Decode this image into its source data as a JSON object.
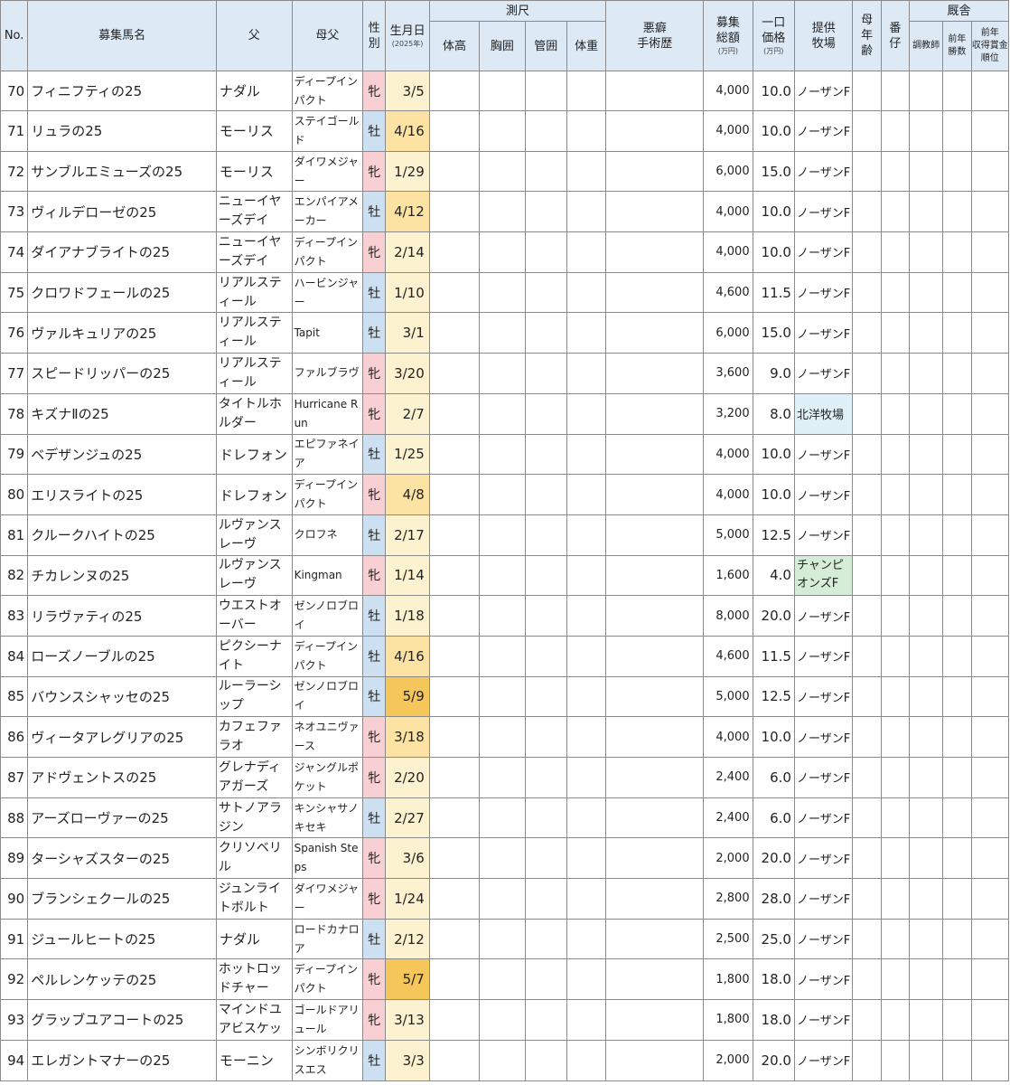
{
  "headers": {
    "no": "No.",
    "name": "募集馬名",
    "sire": "父",
    "dam_sire": "母父",
    "sex": "性別",
    "birth": "生月日",
    "birth_year": "(2025年)",
    "measure_group": "測尺",
    "height": "体高",
    "chest": "胸囲",
    "cannon": "管囲",
    "weight": "体重",
    "vice_line1": "悪癖",
    "vice_line2": "手術歴",
    "total_line1": "募集",
    "total_line2": "総額",
    "total_unit": "(万円)",
    "price_line1": "一口",
    "price_line2": "価格",
    "price_unit": "(万円)",
    "farm_line1": "提供",
    "farm_line2": "牧場",
    "dam_age_line1": "母",
    "dam_age_line2": "年",
    "dam_age_line3": "齢",
    "birth_order_line1": "番",
    "birth_order_line2": "仔",
    "stable_group": "厩舎",
    "trainer": "調教師",
    "prev_wins_line1": "前年",
    "prev_wins_line2": "勝数",
    "prev_rank_line1": "前年",
    "prev_rank_line2": "収得賞金",
    "prev_rank_line3": "順位"
  },
  "rows": [
    {
      "no": "70",
      "name": "フィニフティの25",
      "sire": "ナダル",
      "dam_sire": "ディープインパクト",
      "sex": "牝",
      "birth": "3/5",
      "total": "4,000",
      "price": "10.0",
      "farm": "ノーザンF"
    },
    {
      "no": "71",
      "name": "リュラの25",
      "sire": "モーリス",
      "dam_sire": "ステイゴールド",
      "sex": "牡",
      "birth": "4/16",
      "total": "4,000",
      "price": "10.0",
      "farm": "ノーザンF"
    },
    {
      "no": "72",
      "name": "サンブルエミューズの25",
      "sire": "モーリス",
      "dam_sire": "ダイワメジャー",
      "sex": "牝",
      "birth": "1/29",
      "total": "6,000",
      "price": "15.0",
      "farm": "ノーザンF"
    },
    {
      "no": "73",
      "name": "ヴィルデローゼの25",
      "sire": "ニューイヤーズデイ",
      "dam_sire": "エンパイアメーカー",
      "sex": "牡",
      "birth": "4/12",
      "total": "4,000",
      "price": "10.0",
      "farm": "ノーザンF"
    },
    {
      "no": "74",
      "name": "ダイアナブライトの25",
      "sire": "ニューイヤーズデイ",
      "dam_sire": "ディープインパクト",
      "sex": "牝",
      "birth": "2/14",
      "total": "4,000",
      "price": "10.0",
      "farm": "ノーザンF"
    },
    {
      "no": "75",
      "name": "クロワドフェールの25",
      "sire": "リアルスティール",
      "dam_sire": "ハービンジャー",
      "sex": "牡",
      "birth": "1/10",
      "total": "4,600",
      "price": "11.5",
      "farm": "ノーザンF"
    },
    {
      "no": "76",
      "name": "ヴァルキュリアの25",
      "sire": "リアルスティール",
      "dam_sire": "Tapit",
      "sex": "牡",
      "birth": "3/1",
      "total": "6,000",
      "price": "15.0",
      "farm": "ノーザンF"
    },
    {
      "no": "77",
      "name": "スピードリッパーの25",
      "sire": "リアルスティール",
      "dam_sire": "ファルブラヴ",
      "sex": "牝",
      "birth": "3/20",
      "total": "3,600",
      "price": "9.0",
      "farm": "ノーザンF"
    },
    {
      "no": "78",
      "name": "キズナⅡの25",
      "sire": "タイトルホルダー",
      "dam_sire": "Hurricane Run",
      "sex": "牝",
      "birth": "2/7",
      "total": "3,200",
      "price": "8.0",
      "farm": "北洋牧場"
    },
    {
      "no": "79",
      "name": "ベデザンジュの25",
      "sire": "ドレフォン",
      "dam_sire": "エピファネイア",
      "sex": "牡",
      "birth": "1/25",
      "total": "4,000",
      "price": "10.0",
      "farm": "ノーザンF"
    },
    {
      "no": "80",
      "name": "エリスライトの25",
      "sire": "ドレフォン",
      "dam_sire": "ディープインパクト",
      "sex": "牝",
      "birth": "4/8",
      "total": "4,000",
      "price": "10.0",
      "farm": "ノーザンF"
    },
    {
      "no": "81",
      "name": "クルークハイトの25",
      "sire": "ルヴァンスレーヴ",
      "dam_sire": "クロフネ",
      "sex": "牡",
      "birth": "2/17",
      "total": "5,000",
      "price": "12.5",
      "farm": "ノーザンF"
    },
    {
      "no": "82",
      "name": "チカレンヌの25",
      "sire": "ルヴァンスレーヴ",
      "dam_sire": "Kingman",
      "sex": "牝",
      "birth": "1/14",
      "total": "1,600",
      "price": "4.0",
      "farm": "チャンピオンズF"
    },
    {
      "no": "83",
      "name": "リラヴァティの25",
      "sire": "ウエストオーバー",
      "dam_sire": "ゼンノロブロイ",
      "sex": "牡",
      "birth": "1/18",
      "total": "8,000",
      "price": "20.0",
      "farm": "ノーザンF"
    },
    {
      "no": "84",
      "name": "ローズノーブルの25",
      "sire": "ピクシーナイト",
      "dam_sire": "ディープインパクト",
      "sex": "牡",
      "birth": "4/16",
      "total": "4,600",
      "price": "11.5",
      "farm": "ノーザンF"
    },
    {
      "no": "85",
      "name": "バウンスシャッセの25",
      "sire": "ルーラーシップ",
      "dam_sire": "ゼンノロブロイ",
      "sex": "牡",
      "birth": "5/9",
      "total": "5,000",
      "price": "12.5",
      "farm": "ノーザンF"
    },
    {
      "no": "86",
      "name": "ヴィータアレグリアの25",
      "sire": "カフェファラオ",
      "dam_sire": "ネオユニヴァース",
      "sex": "牝",
      "birth": "3/18",
      "total": "4,000",
      "price": "10.0",
      "farm": "ノーザンF"
    },
    {
      "no": "87",
      "name": "アドヴェントスの25",
      "sire": "グレナディアガーズ",
      "dam_sire": "ジャングルポケット",
      "sex": "牝",
      "birth": "2/20",
      "total": "2,400",
      "price": "6.0",
      "farm": "ノーザンF"
    },
    {
      "no": "88",
      "name": "アーズローヴァーの25",
      "sire": "サトノアラジン",
      "dam_sire": "キンシャサノキセキ",
      "sex": "牡",
      "birth": "2/27",
      "total": "2,400",
      "price": "6.0",
      "farm": "ノーザンF"
    },
    {
      "no": "89",
      "name": "ターシャズスターの25",
      "sire": "クリソベリル",
      "dam_sire": "Spanish Steps",
      "sex": "牝",
      "birth": "3/6",
      "total": "2,000",
      "price": "20.0",
      "farm": "ノーザンF"
    },
    {
      "no": "90",
      "name": "ブランシェクールの25",
      "sire": "ジュンライトボルト",
      "dam_sire": "ダイワメジャー",
      "sex": "牝",
      "birth": "1/24",
      "total": "2,800",
      "price": "28.0",
      "farm": "ノーザンF"
    },
    {
      "no": "91",
      "name": "ジュールヒートの25",
      "sire": "ナダル",
      "dam_sire": "ロードカナロア",
      "sex": "牡",
      "birth": "2/12",
      "total": "2,500",
      "price": "25.0",
      "farm": "ノーザンF"
    },
    {
      "no": "92",
      "name": "ペルレンケッテの25",
      "sire": "ホットロッドチャー",
      "dam_sire": "ディープインパクト",
      "sex": "牝",
      "birth": "5/7",
      "total": "1,800",
      "price": "18.0",
      "farm": "ノーザンF"
    },
    {
      "no": "93",
      "name": "グラッブユアコートの25",
      "sire": "マインドユアビスケッ",
      "dam_sire": "ゴールドアリュール",
      "sex": "牝",
      "birth": "3/13",
      "total": "1,800",
      "price": "18.0",
      "farm": "ノーザンF"
    },
    {
      "no": "94",
      "name": "エレガントマナーの25",
      "sire": "モーニン",
      "dam_sire": "シンボリクリスエス",
      "sex": "牡",
      "birth": "3/3",
      "total": "2,000",
      "price": "20.0",
      "farm": "ノーザンF"
    }
  ]
}
